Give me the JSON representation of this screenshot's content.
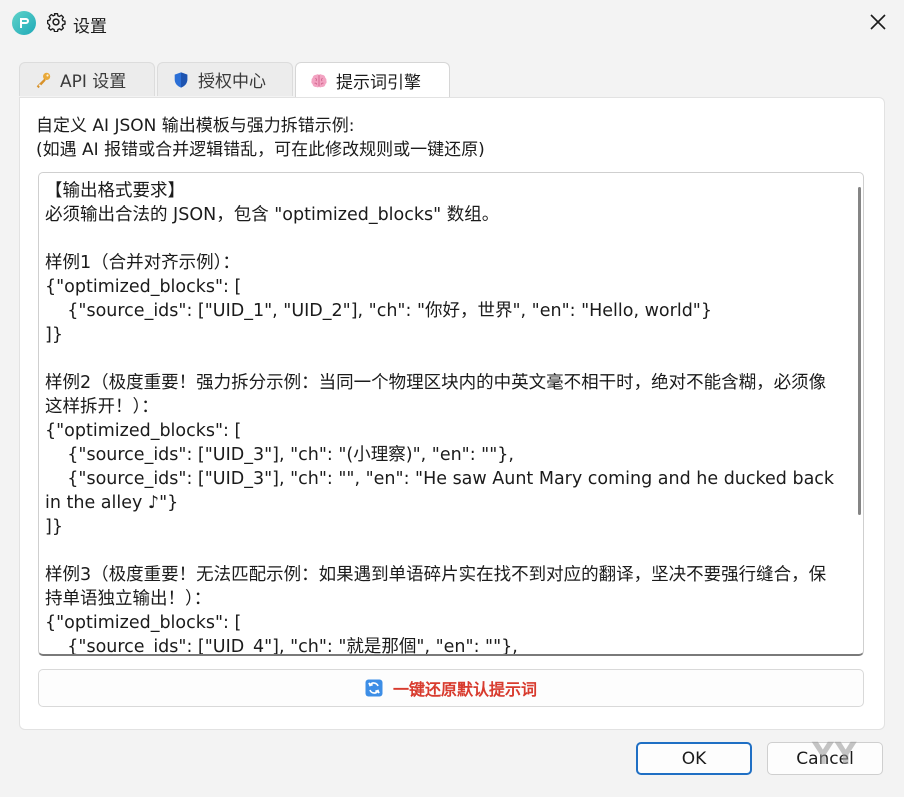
{
  "window": {
    "title": "设置"
  },
  "tabs": [
    {
      "label": "API 设置",
      "icon": "key-icon"
    },
    {
      "label": "授权中心",
      "icon": "shield-icon"
    },
    {
      "label": "提示词引擎",
      "icon": "brain-icon",
      "active": true
    }
  ],
  "panel": {
    "desc_line1": "自定义 AI JSON 输出模板与强力拆错示例:",
    "desc_line2": "(如遇 AI 报错或合并逻辑错乱，可在此修改规则或一键还原)",
    "template_text": "【输出格式要求】\n必须输出合法的 JSON，包含 \"optimized_blocks\" 数组。\n\n样例1（合并对齐示例）：\n{\"optimized_blocks\": [\n    {\"source_ids\": [\"UID_1\", \"UID_2\"], \"ch\": \"你好，世界\", \"en\": \"Hello, world\"}\n]}\n\n样例2（极度重要！强力拆分示例：当同一个物理区块内的中英文毫不相干时，绝对不能含糊，必须像这样拆开！）：\n{\"optimized_blocks\": [\n    {\"source_ids\": [\"UID_3\"], \"ch\": \"(小理察)\", \"en\": \"\"},\n    {\"source_ids\": [\"UID_3\"], \"ch\": \"\", \"en\": \"He saw Aunt Mary coming and he ducked back in the alley ♪\"}\n]}\n\n样例3（极度重要！无法匹配示例：如果遇到单语碎片实在找不到对应的翻译，坚决不要强行缝合，保持单语独立输出！）：\n{\"optimized_blocks\": [\n    {\"source_ids\": [\"UID_4\"], \"ch\": \"就是那個\", \"en\": \"\"},",
    "reset_label": "一键还原默认提示词"
  },
  "buttons": {
    "ok": "OK",
    "cancel": "Cancel"
  },
  "colors": {
    "accent": "#1f6fc4",
    "reset_text": "#d83b2e"
  }
}
